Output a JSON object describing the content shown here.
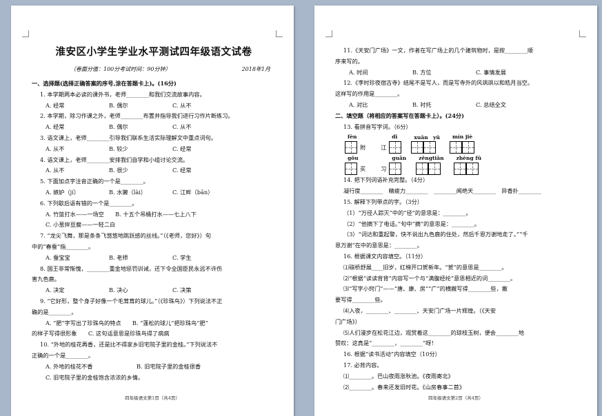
{
  "page1": {
    "title": "淮安区小学生学业水平测试四年级语文试卷",
    "subtitle_left": "（卷面分值：100分考试时间：90分钟）",
    "subtitle_right": "2018年1月",
    "lines": [
      {
        "t": "一、选择题(选择正确答案的序号,涂在答题卡上)。(16分)",
        "k": "section"
      },
      {
        "t": "1. 本学期两本必读的课外书，老师________和我们交流故事内容。",
        "k": "q"
      },
      {
        "k": "opts",
        "o": [
          "A. 经常",
          "B. 偶尔",
          "C. 从不"
        ]
      },
      {
        "t": "2. 本学期，除习作课之外，老师________布置并指导我们进行习作片断练习。",
        "k": "q"
      },
      {
        "k": "opts",
        "o": [
          "A. 经常",
          "B. 偶尔",
          "C. 从不"
        ]
      },
      {
        "t": "3. 语文课上，老师________引导我们联系生活实际理解文中重点词句。",
        "k": "q"
      },
      {
        "k": "opts",
        "o": [
          "A. 从不",
          "B. 较少",
          "C. 经常"
        ]
      },
      {
        "t": "4. 语文课上，老师________安排我们自学和小组讨论交流。",
        "k": "q"
      },
      {
        "k": "opts",
        "o": [
          "A. 从不",
          "B. 很少",
          "C. 经常"
        ]
      },
      {
        "t": "5. 下面加点字注音正确的一个是________。",
        "k": "q"
      },
      {
        "k": "opts",
        "o": [
          "A. 嫉妒（jí）",
          "B. 水獭（lài）",
          "C. 江畔（bān）"
        ]
      },
      {
        "t": "6. 下列歇后语有错的一个是________。",
        "k": "q"
      },
      {
        "t": "A. 竹篮打水——一场空　　B. 十五个吊桶打水——七上八下",
        "k": "opt-line"
      },
      {
        "t": "C. 小葱拌豆腐——一轻二白",
        "k": "opt-line"
      },
      {
        "t": "7. “龙尖飞舞，那是条条飞悠悠地跳跃感的丝线。”（《老师，您好》）句",
        "k": "q"
      },
      {
        "t": "中的“春蚕”指________。",
        "k": "q2"
      },
      {
        "k": "opts",
        "o": [
          "A. 蚕宝宝",
          "B. 老师",
          "C. 学生"
        ]
      },
      {
        "t": "8. 国王非常惭愧，________重金地惩罚训诫，还下令全国臣民永远不许伤",
        "k": "q"
      },
      {
        "t": "害九色鹿。",
        "k": "q2"
      },
      {
        "k": "opts",
        "o": [
          "A. 决定",
          "B. 决心",
          "C. 决策"
        ]
      },
      {
        "t": "9. “它好形，整个身子好像一个毛茸茸的球儿。”（《珍珠鸟》）下列说法不正",
        "k": "q"
      },
      {
        "t": "确的是________。",
        "k": "q2"
      },
      {
        "t": "A. “肥”字写出了珍珠鸟的特点　　B. “蓬松的球儿”把珍珠鸟“肥”",
        "k": "opt-line"
      },
      {
        "t": "的样子写得很形象　　C. 这句话意思是珍珠鸟得了病病",
        "k": "q2"
      },
      {
        "t": "10. “外地的桂花再香，还是比不得家乡旧宅院子里的金桂。”下列说法不",
        "k": "q"
      },
      {
        "t": "正确的一个是________。",
        "k": "q2"
      },
      {
        "k": "opts",
        "o": [
          "A. 外地的桂花不香",
          "B. 旧宅院子里的金桂很香"
        ],
        "w": 108
      },
      {
        "t": "C. 旧宅院子里的金桂饱含浓浓的乡情。",
        "k": "opt-line"
      }
    ],
    "footer": "四年级语文第1页（共4页）"
  },
  "page2": {
    "lines_a": [
      {
        "t": "11.《天安门广场》一文，作者在写广场上的几个建筑物时，是按________顺",
        "k": "q"
      },
      {
        "t": "序来写的。",
        "k": "q2"
      },
      {
        "k": "opts",
        "o": [
          "A. 时间",
          "B. 方位",
          "C. 事情发展"
        ]
      },
      {
        "t": "12.《李时珍夜宿古寺》结尾不是写人，而是写寺外的风飒飒以和皓月当空。",
        "k": "q"
      },
      {
        "t": "这样写的作用是________。",
        "k": "q2"
      },
      {
        "k": "opts",
        "o": [
          "A. 对比",
          "B. 衬托",
          "C. 总结全文"
        ]
      },
      {
        "t": "二、填空题（将相应的答案写在答题卡上）。(24分)",
        "k": "section"
      },
      {
        "t": "13. 看拼音写字词。（6分）",
        "k": "q"
      }
    ],
    "pinyin": {
      "row1": [
        {
          "py": "fèn",
          "n": 1,
          "after": "附"
        },
        {
          "py": "dī",
          "n": 1,
          "before": "江",
          "pre": true
        },
        {
          "py": "xuān　yǔ",
          "n": 2
        },
        {
          "py": "mín jiè",
          "n": 2
        }
      ],
      "row2": [
        {
          "py": "gōu",
          "n": 1,
          "after": "买"
        },
        {
          "py": "guǎn",
          "n": 1,
          "before": "习",
          "pre": true
        },
        {
          "py": "zēngtiān",
          "n": 2
        },
        {
          "py": "zhèng fǔ",
          "n": 2
        }
      ]
    },
    "lines_b": [
      {
        "t": "14. 把下列词语补充完整。（4分）",
        "k": "q"
      },
      {
        "t": "凝行度________　精疲力________　________闻绝天________　异香扑________",
        "k": "q"
      },
      {
        "t": "15. 解释下列带点的字。（3分）",
        "k": "q"
      },
      {
        "t": "（1）“万径人踪灭”中的“径”的意思是：________。",
        "k": "q"
      },
      {
        "t": "（2）“他摘下了电话。”句中“摘”的意思是：________。",
        "k": "q"
      },
      {
        "t": "（3）“词达和重起警，快不说出九色鹿的住处，然后千恩万谢地走了。”“千",
        "k": "q"
      },
      {
        "t": "恩万谢”在中的意思是：________。",
        "k": "q2"
      },
      {
        "t": "16. 根据课文内容填空。（11分）",
        "k": "q"
      },
      {
        "t": "⑴碳桥舒展____旧岁，红梯开口贺新年。“贺”的意思是________。",
        "k": "q"
      },
      {
        "t": "⑵“根据“读读背背”内容写一个与“满腹经纶”意思相近的词________。",
        "k": "q"
      },
      {
        "t": "⑶“写字小窍门”——“唐、康、房”“广”的横撇写得________些，撇",
        "k": "q"
      },
      {
        "t": "要写得________些。",
        "k": "q2"
      },
      {
        "t": "⑷入夜，________、________、天安门广场一片辉煌。（《天安",
        "k": "q"
      },
      {
        "t": "门广场》）",
        "k": "q2"
      },
      {
        "t": "⑸人们漫步在松花江边，观赏着这________的琼枝玉树，便会________地",
        "k": "q"
      },
      {
        "t": "赞叹：这真是“________，________”呀！",
        "k": "q2"
      },
      {
        "t": "16. 根据“读书活动”内容填空（10分）",
        "k": "q"
      },
      {
        "t": "17. 必背内容。",
        "k": "q"
      },
      {
        "t": "⑴________。巴山夜雨涨秋池。《夜雨寄北》",
        "k": "q"
      },
      {
        "t": "⑵________。春来还发旧时花。《山房春事二首》",
        "k": "q"
      }
    ],
    "footer": "四年级语文第2页（共4页）"
  }
}
